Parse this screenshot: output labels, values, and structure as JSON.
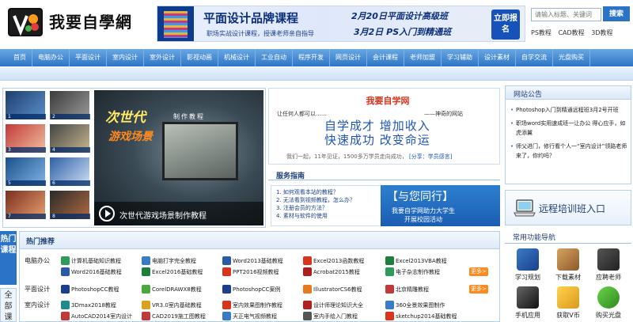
{
  "header": {
    "logo_text": "我要自學網",
    "search_placeholder": "请输入标题、关键词",
    "search_button": "搜索",
    "quick_links": [
      "PS教程",
      "CAD教程",
      "3D教程"
    ]
  },
  "banner": {
    "title": "平面设计品牌课程",
    "subtitle": "职场实战设计课程，授课老师亲自指导",
    "line1": "2月20日平面设计高级班",
    "line2": "3月2日 PS入门到精通班",
    "button": "立即报名"
  },
  "nav": [
    "首页",
    "电脑办公",
    "平面设计",
    "室内设计",
    "室外设计",
    "影视动画",
    "机械设计",
    "工业自动",
    "程序开发",
    "网页设计",
    "会计课程",
    "老师加盟",
    "学习辅助",
    "设计素材",
    "自学交流",
    "光盘购买"
  ],
  "slider": {
    "thumb_numbers": [
      "1",
      "2",
      "3",
      "4",
      "5",
      "6",
      "7",
      "8"
    ],
    "main_t1": "次世代",
    "main_t2": "游戏场景",
    "main_t3": "制作教程",
    "caption": "次世代游戏场景制作教程"
  },
  "intro": {
    "title": "我要自学网",
    "left_note": "让任何人都可以……",
    "right_note": "——神奇的网站",
    "slogan1": "自学成才  增加收入",
    "slogan2": "快速成功  改变命运",
    "footer": "我们一起，11年见证，1500多万学员走向成功，",
    "footer_link": "[分享：学员感言]"
  },
  "service": {
    "heading": "服务指南",
    "items": [
      "1. 如何观看本站的教程？",
      "2. 无法看到视频教程，怎么办？",
      "3. 注册会员的方法？",
      "4. 素材与软件的使用"
    ],
    "banner_title": "【与您同行】",
    "banner_sub1": "我要自学网助力大学生",
    "banner_sub2": "开展校园活动"
  },
  "notice": {
    "heading": "网站公告",
    "items": [
      "Photoshop入门到精通远程班3月2号开班",
      "职场word实用速成班一让办公 得心应手，如虎添翼",
      "师父进门，修行看个人一“室内设计”领路老师来了，你约吗？"
    ],
    "remote": "远程培训班入口"
  },
  "hot": {
    "tab_hot": "热门课程",
    "tab_all": "全部课",
    "heading": "热门推荐",
    "more": "更多>",
    "rows": [
      {
        "category": "电脑办公",
        "courses": [
          "计算机基础知识教程",
          "电脑打字完全教程",
          "Word2013基础教程",
          "Excel2013函数教程",
          "Excel2013VBA教程"
        ]
      },
      {
        "category": "",
        "courses": [
          "Word2016基础教程",
          "Excel2016基础教程",
          "PPT2016视频教程",
          "Acrobat2015教程",
          "电子杂志制作教程"
        ]
      },
      {
        "category": "平面设计",
        "courses": [
          "PhotoshopCC教程",
          "CorelDRAWX8教程",
          "PhotoshopCC案例",
          "IllustratorCS6教程",
          "北京精雕教程"
        ]
      },
      {
        "category": "室内设计",
        "courses": [
          "3Dmax2018教程",
          "VR3.0室内基础教程",
          "室内效果图制作教程",
          "设计师理论知识大全",
          "360全景效果图制作"
        ]
      },
      {
        "category": "",
        "courses": [
          "AutoCAD2014室内设计",
          "CAD2019施工图教程",
          "天正电气视频教程",
          "室内手绘入门教程",
          "sketchup2014基础教程"
        ]
      }
    ]
  },
  "common_nav": {
    "heading": "常用功能导航",
    "items": [
      "学习规划",
      "下载素材",
      "应聘老师",
      "手机应用",
      "获取V币",
      "购买光盘"
    ]
  },
  "colors": {
    "nav_blue": "#2d75c6",
    "accent_red": "#d9341c",
    "accent_orange": "#ff8a1e",
    "text_blue": "#1f55b8"
  }
}
